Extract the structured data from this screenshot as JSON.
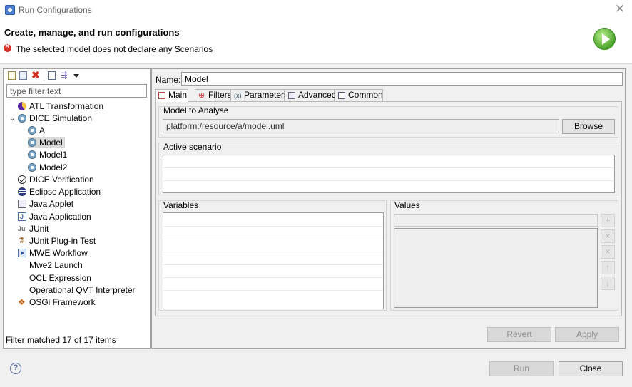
{
  "window": {
    "title": "Run Configurations",
    "close_glyph": "✕"
  },
  "header": {
    "title": "Create, manage, and run configurations",
    "error_message": "The selected model does not declare any Scenarios",
    "run_icon": "run-launch-icon"
  },
  "left": {
    "toolbar": [
      "new-config-icon",
      "duplicate-icon",
      "delete-icon",
      "collapse-all-icon",
      "filter-icon",
      "dropdown-arrow-icon"
    ],
    "filter_placeholder": "type filter text",
    "tree": [
      {
        "label": "ATL Transformation",
        "icon": "atl-icon"
      },
      {
        "label": "DICE Simulation",
        "icon": "dice-simulation-icon",
        "expanded": true,
        "children": [
          {
            "label": "A",
            "icon": "dice-config-icon"
          },
          {
            "label": "Model",
            "icon": "dice-config-icon",
            "selected": true
          },
          {
            "label": "Model1",
            "icon": "dice-config-icon"
          },
          {
            "label": "Model2",
            "icon": "dice-config-icon"
          }
        ]
      },
      {
        "label": "DICE Verification",
        "icon": "check-circle-icon"
      },
      {
        "label": "Eclipse Application",
        "icon": "eclipse-icon"
      },
      {
        "label": "Java Applet",
        "icon": "applet-icon"
      },
      {
        "label": "Java Application",
        "icon": "java-app-icon"
      },
      {
        "label": "JUnit",
        "icon": "junit-icon"
      },
      {
        "label": "JUnit Plug-in Test",
        "icon": "plugin-test-icon"
      },
      {
        "label": "MWE Workflow",
        "icon": "mwe-icon"
      },
      {
        "label": "Mwe2 Launch",
        "icon": ""
      },
      {
        "label": "OCL Expression",
        "icon": ""
      },
      {
        "label": "Operational QVT Interpreter",
        "icon": ""
      },
      {
        "label": "OSGi Framework",
        "icon": "osgi-icon"
      }
    ],
    "status": "Filter matched 17 of 17 items"
  },
  "right": {
    "name_label": "Name:",
    "name_value": "Model",
    "tabs": [
      {
        "label": "Main",
        "icon": "main-tab-icon",
        "active": true
      },
      {
        "label": "Filters",
        "icon": "filters-tab-icon"
      },
      {
        "label": "Parameters",
        "icon": "parameters-tab-icon"
      },
      {
        "label": "Advanced",
        "icon": "advanced-tab-icon"
      },
      {
        "label": "Common",
        "icon": "common-tab-icon"
      }
    ],
    "model_section": "Model to Analyse",
    "model_path": "platform:/resource/a/model.uml",
    "browse_label": "Browse",
    "scenario_section": "Active scenario",
    "variables_label": "Variables",
    "values_label": "Values",
    "value_buttons": [
      "+",
      "×",
      "×",
      "↑",
      "↓"
    ],
    "revert_label": "Revert",
    "apply_label": "Apply"
  },
  "footer": {
    "help_glyph": "?",
    "run_label": "Run",
    "close_label": "Close"
  }
}
